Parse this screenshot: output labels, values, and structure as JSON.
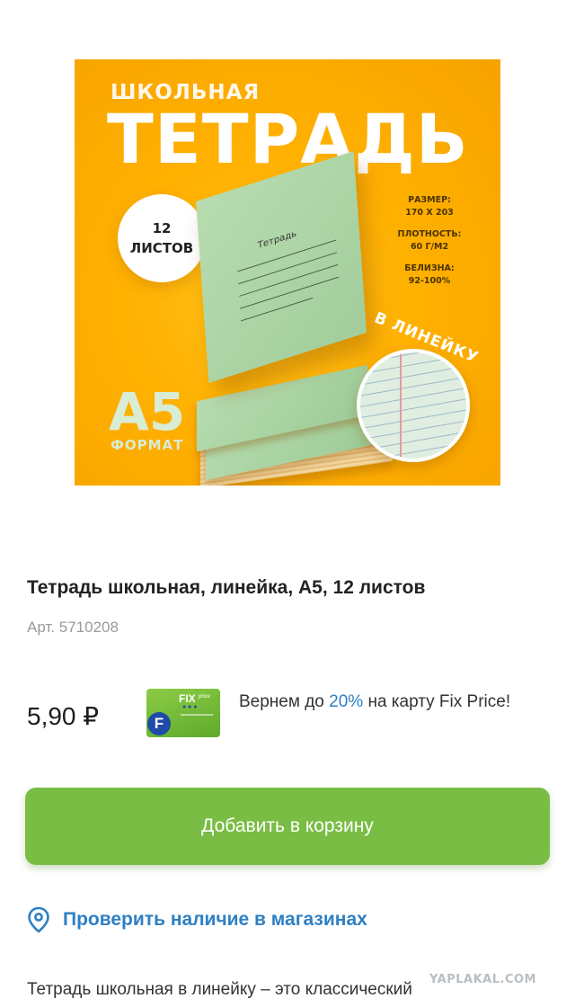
{
  "product_image": {
    "subtitle": "ШКОЛЬНАЯ",
    "title": "ТЕТРАДЬ",
    "sheets_count": "12",
    "sheets_word": "ЛИСТОВ",
    "specs": [
      {
        "label": "РАЗМЕР:",
        "value": "170 Х 203"
      },
      {
        "label": "ПЛОТНОСТЬ:",
        "value": "60 Г/М2"
      },
      {
        "label": "БЕЛИЗНА:",
        "value": "92-100%"
      }
    ],
    "notebook_label": "Тетрадь",
    "format_big": "А5",
    "format_small": "ФОРМАТ",
    "ruled_label": "В ЛИНЕЙКУ",
    "colors": {
      "background": "#ffb000",
      "notebook": "#a9d3a2"
    }
  },
  "product": {
    "title": "Тетрадь школьная, линейка, А5, 12 листов",
    "sku": "Арт. 5710208",
    "price": "5,90 ₽"
  },
  "loyalty_card": {
    "brand": "FIX",
    "brand_suffix": "price",
    "icon": "fix-price-card-icon"
  },
  "cashback": {
    "prefix": "Вернем до ",
    "percent": "20%",
    "suffix": " на карту Fix Price!",
    "accent_color": "#2e7fc3"
  },
  "actions": {
    "add_to_cart_label": "Добавить в корзину",
    "add_to_cart_color": "#7abd45",
    "check_stores_label": "Проверить наличие в магазинах",
    "check_stores_icon": "location-pin-icon"
  },
  "description": {
    "text": "Тетрадь школьная в линейку – это классический"
  },
  "watermark": "YAPLAKAL.COM"
}
